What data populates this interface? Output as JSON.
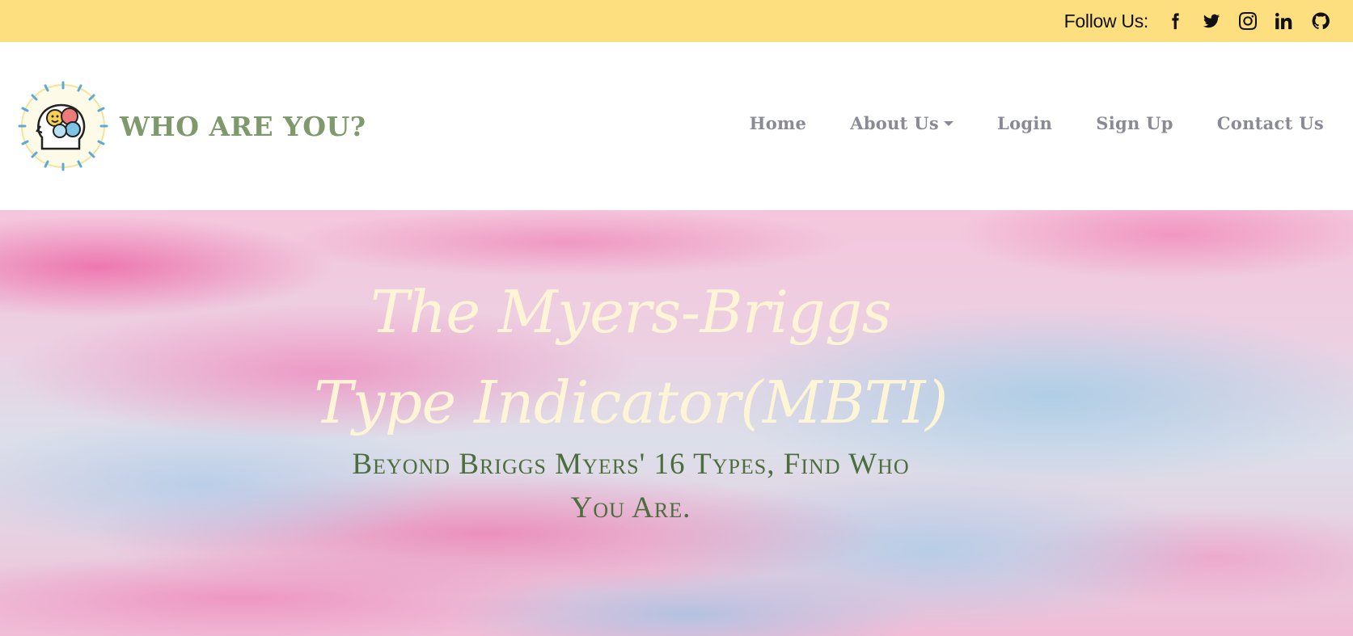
{
  "topbar": {
    "follow_label": "Follow Us:",
    "background": "#fddf80",
    "social": [
      {
        "icon": "facebook-icon"
      },
      {
        "icon": "twitter-icon"
      },
      {
        "icon": "instagram-icon"
      },
      {
        "icon": "linkedin-icon"
      },
      {
        "icon": "github-icon"
      }
    ]
  },
  "brand": {
    "name": "WHO ARE YOU?",
    "color": "#7e9a6c"
  },
  "nav": {
    "items": [
      {
        "label": "Home"
      },
      {
        "label": "About Us",
        "dropdown": true
      },
      {
        "label": "Login"
      },
      {
        "label": "Sign Up"
      },
      {
        "label": "Contact Us"
      }
    ],
    "color": "#8a8a95"
  },
  "hero": {
    "title": "The Myers-Briggs Type Indicator(MBTI)",
    "subtitle": "Beyond Briggs Myers' 16 Types, Find Who You Are.",
    "title_color": "#fdf5d6",
    "subtitle_color": "#4a6e3c"
  }
}
